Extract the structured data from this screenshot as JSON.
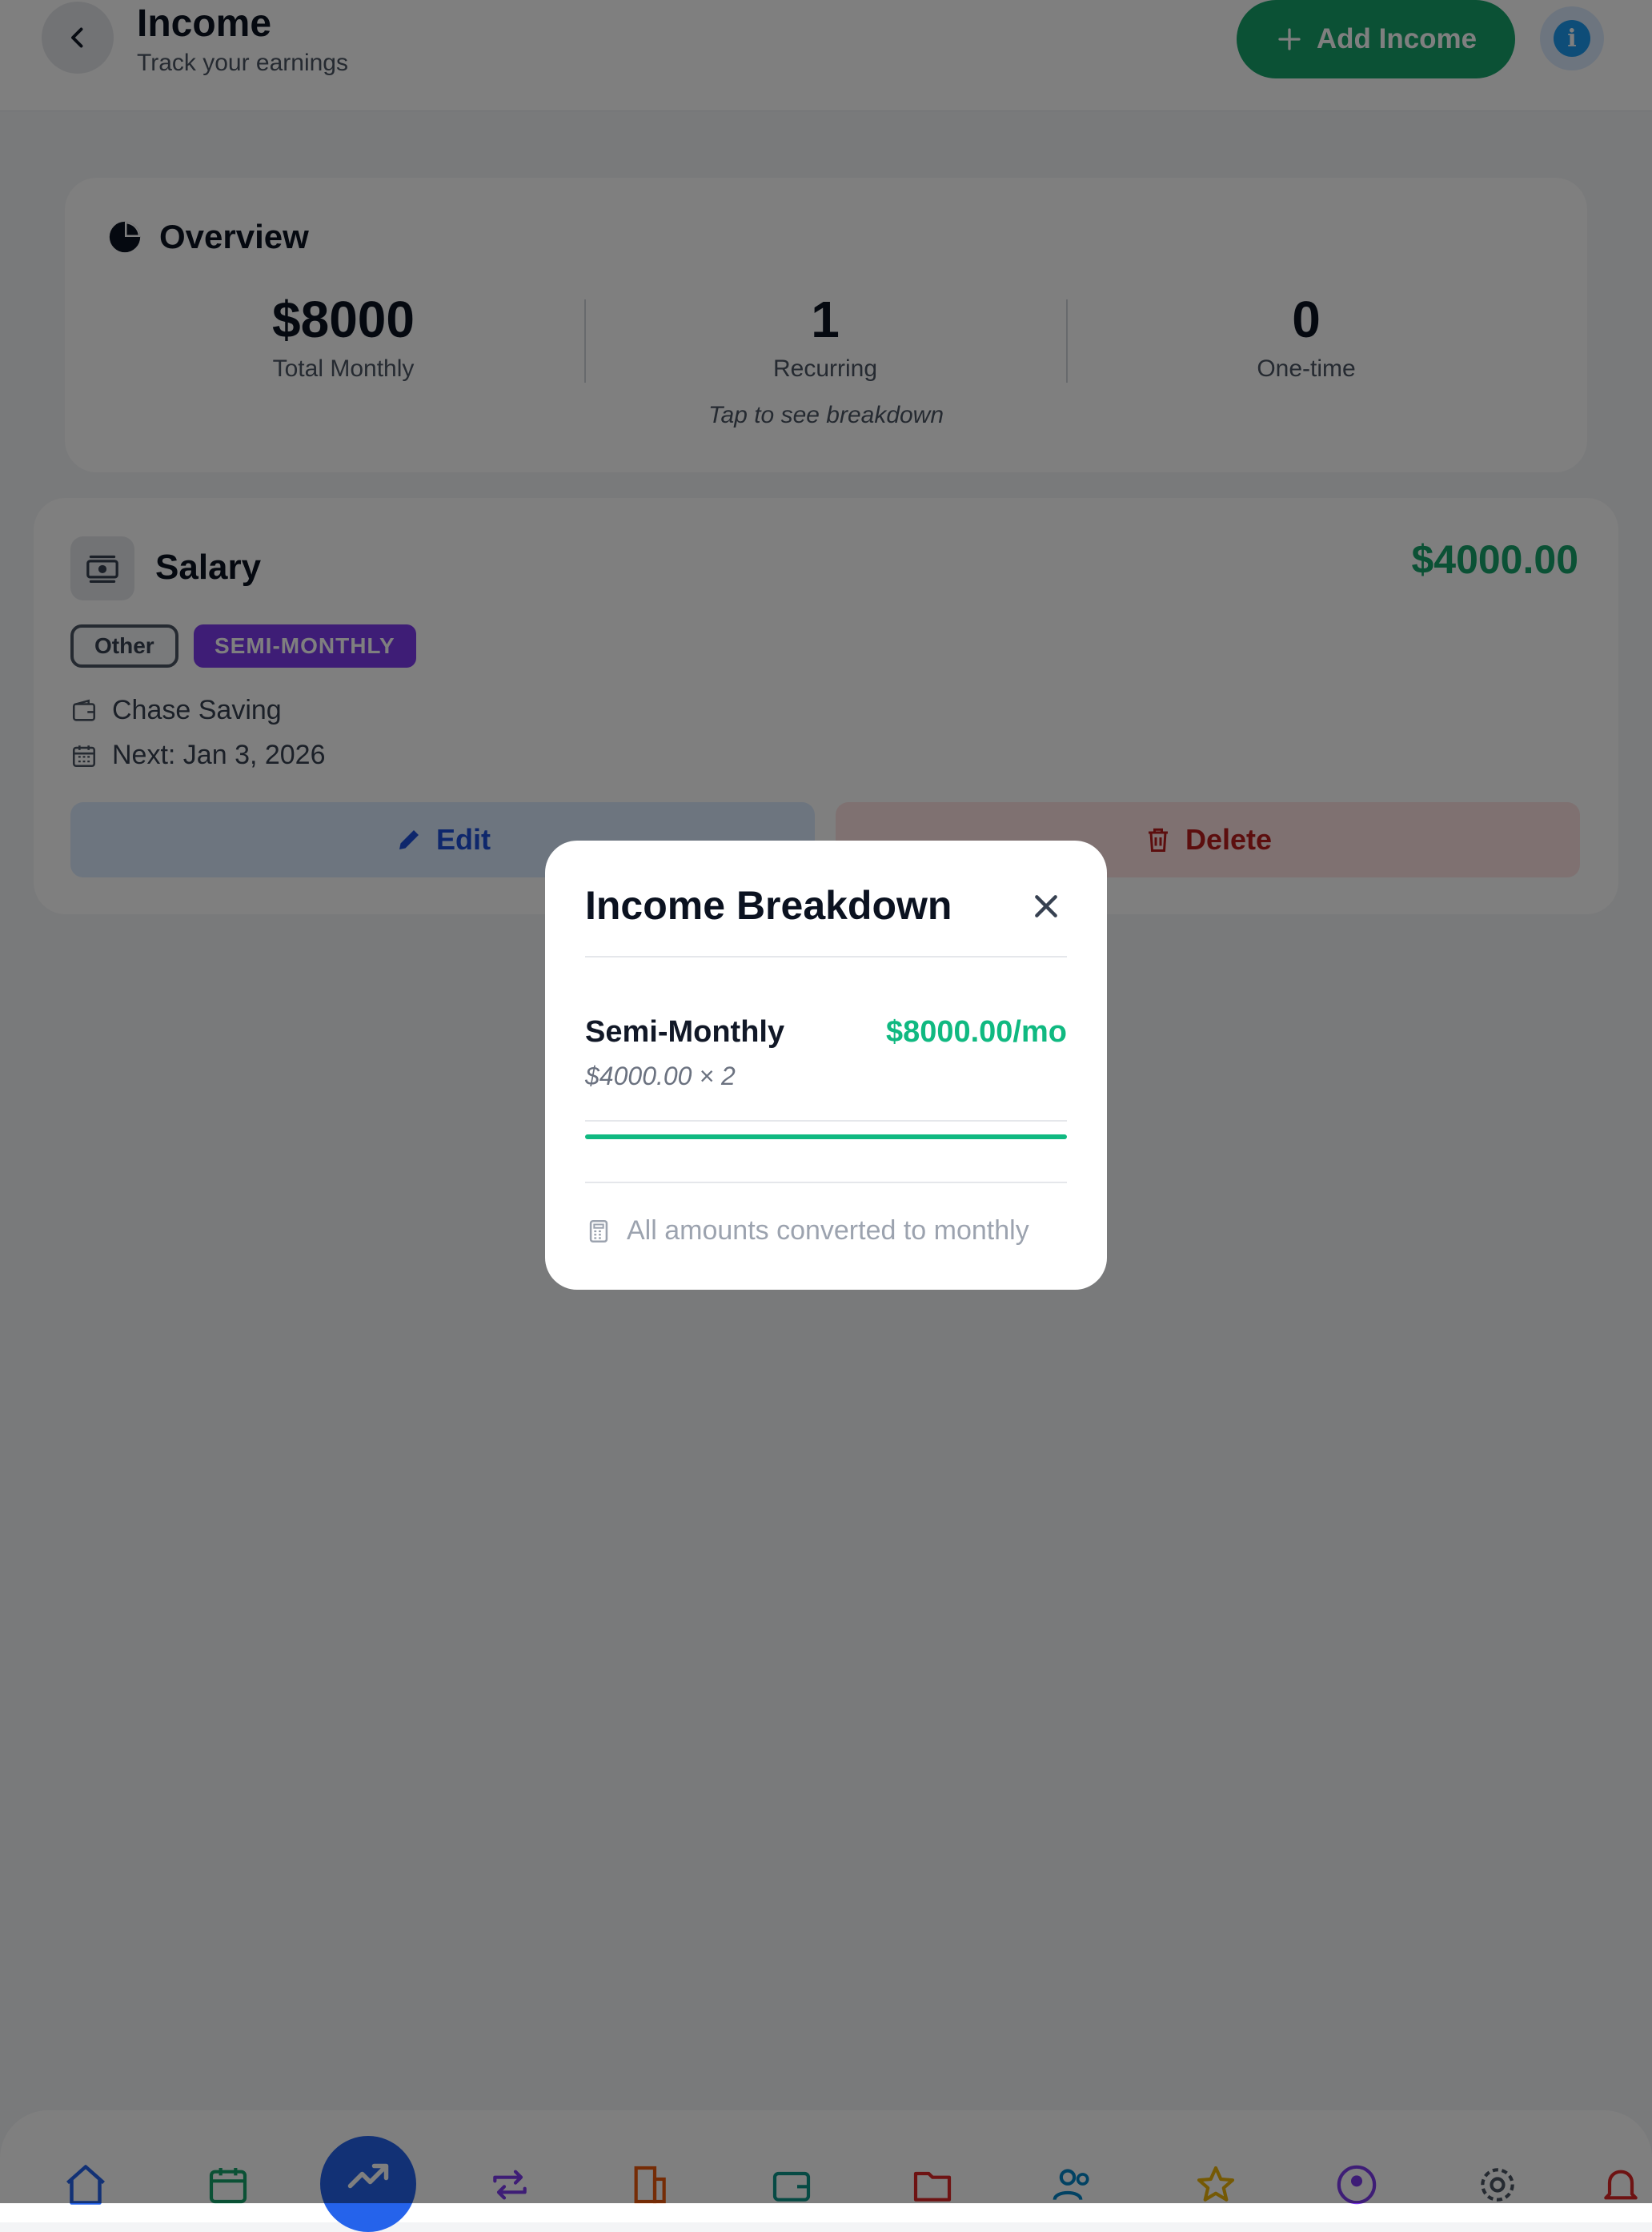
{
  "header": {
    "title": "Income",
    "subtitle": "Track your earnings",
    "add_button_label": "Add Income"
  },
  "overview": {
    "title": "Overview",
    "stats": [
      {
        "value": "$8000",
        "label": "Total Monthly"
      },
      {
        "value": "1",
        "label": "Recurring"
      },
      {
        "value": "0",
        "label": "One-time"
      }
    ],
    "hint": "Tap to see breakdown"
  },
  "income_items": [
    {
      "name": "Salary",
      "amount": "$4000.00",
      "category_tag": "Other",
      "frequency_tag": "SEMI-MONTHLY",
      "account": "Chase Saving",
      "next": "Next: Jan 3, 2026",
      "edit_label": "Edit",
      "delete_label": "Delete"
    }
  ],
  "modal": {
    "title": "Income Breakdown",
    "rows": [
      {
        "label": "Semi-Monthly",
        "amount": "$8000.00/mo",
        "detail": "$4000.00 × 2",
        "share": 1.0
      }
    ],
    "footer": "All amounts converted to monthly"
  },
  "bottom_nav": {
    "items": [
      {
        "icon": "home-icon",
        "color": "#2563eb"
      },
      {
        "icon": "calendar-icon",
        "color": "#16a36b"
      },
      {
        "icon": "trending-up-icon",
        "color": "#ffffff",
        "active": true
      },
      {
        "icon": "repeat-icon",
        "color": "#7c3aed"
      },
      {
        "icon": "building-icon",
        "color": "#ea580c"
      },
      {
        "icon": "wallet-icon",
        "color": "#0d9488"
      },
      {
        "icon": "folder-icon",
        "color": "#dc2626"
      },
      {
        "icon": "users-icon",
        "color": "#0284c7"
      },
      {
        "icon": "star-icon",
        "color": "#eab308"
      },
      {
        "icon": "profile-icon",
        "color": "#7c3aed"
      },
      {
        "icon": "settings-icon",
        "color": "#4b5563"
      },
      {
        "icon": "bell-icon",
        "color": "#dc2626"
      }
    ]
  },
  "colors": {
    "accent_green": "#16a36b",
    "income_green": "#10b981",
    "purple": "#7c3aed",
    "blue": "#1d4ed8",
    "red": "#b91c1c"
  }
}
